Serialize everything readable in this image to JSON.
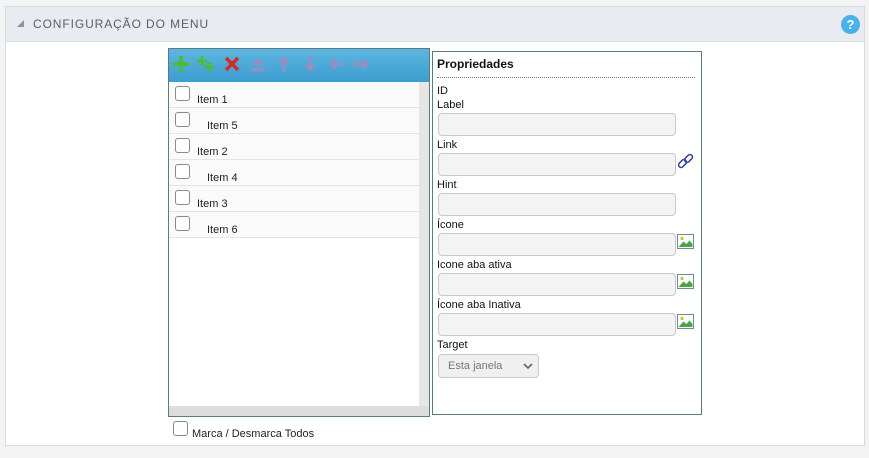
{
  "header": {
    "title": "CONFIGURAÇÃO DO MENU",
    "help_icon": "help-icon",
    "help_text": "?"
  },
  "toolbar": {
    "icons": [
      "add-icon",
      "add-child-icon",
      "delete-icon",
      "move-top-icon",
      "move-up-icon",
      "move-down-icon",
      "move-left-icon",
      "move-right-icon"
    ],
    "colors": {
      "add": "#4cbb3f",
      "delete": "#d42a2a",
      "disabled": "#9b8cc4"
    }
  },
  "tree": {
    "items": [
      {
        "label": "Item 1",
        "checked": false,
        "indented": false
      },
      {
        "label": "Item 5",
        "checked": false,
        "indented": true
      },
      {
        "label": "Item 2",
        "checked": false,
        "indented": false
      },
      {
        "label": "Item 4",
        "checked": false,
        "indented": true
      },
      {
        "label": "Item 3",
        "checked": false,
        "indented": false
      },
      {
        "label": "Item 6",
        "checked": false,
        "indented": true
      }
    ]
  },
  "props": {
    "title": "Propriedades",
    "id_label": "ID",
    "fields": [
      {
        "label": "Label",
        "value": "",
        "icon": ""
      },
      {
        "label": "Link",
        "value": "",
        "icon": "link-icon"
      },
      {
        "label": "Hint",
        "value": "",
        "icon": ""
      },
      {
        "label": "Ícone",
        "value": "",
        "icon": "image-icon"
      },
      {
        "label": "Icone aba ativa",
        "value": "",
        "icon": "image-icon"
      },
      {
        "label": "Ícone aba Inativa",
        "value": "",
        "icon": "image-icon"
      }
    ],
    "target_label": "Target",
    "target_value": "Esta janela"
  },
  "bottom": {
    "toggle_all_label": "Marca / Desmarca Todos",
    "checked": false
  }
}
